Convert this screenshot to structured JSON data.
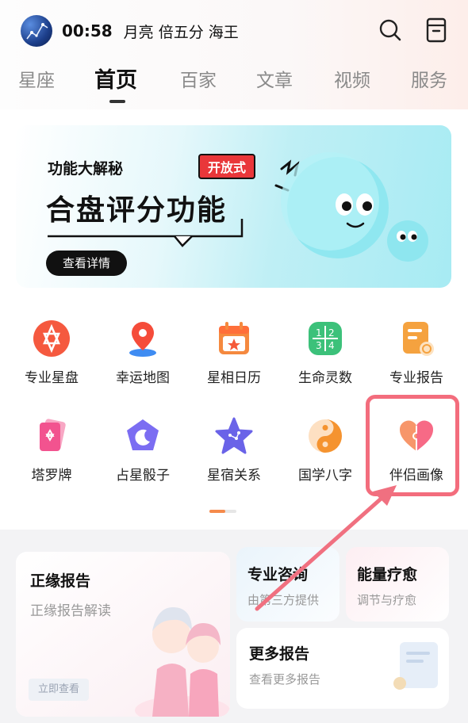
{
  "status": {
    "time": "00:58",
    "text": "月亮 倍五分 海王"
  },
  "header_icons": [
    "search-icon",
    "bookmark-icon"
  ],
  "tabs": [
    {
      "label": "星座",
      "active": false
    },
    {
      "label": "首页",
      "active": true
    },
    {
      "label": "百家",
      "active": false
    },
    {
      "label": "文章",
      "active": false
    },
    {
      "label": "视频",
      "active": false
    },
    {
      "label": "服务",
      "active": false
    }
  ],
  "banner": {
    "subtitle": "功能大解秘",
    "badge": "开放式",
    "title": "合盘评分功能",
    "button": "查看详情"
  },
  "features": [
    {
      "label": "专业星盘",
      "icon": "star-of-david-icon",
      "color": "#f5593f"
    },
    {
      "label": "幸运地图",
      "icon": "map-pin-icon",
      "color": "#f54c3a"
    },
    {
      "label": "星相日历",
      "icon": "calendar-icon",
      "color": "#f5893f"
    },
    {
      "label": "生命灵数",
      "icon": "numbers-grid-icon",
      "color": "#3cc17a"
    },
    {
      "label": "专业报告",
      "icon": "report-icon",
      "color": "#f5a23f"
    },
    {
      "label": "塔罗牌",
      "icon": "tarot-card-icon",
      "color": "#f2538f"
    },
    {
      "label": "占星骰子",
      "icon": "dice-moon-icon",
      "color": "#7b6df2"
    },
    {
      "label": "星宿关系",
      "icon": "star-icon",
      "color": "#6a63e8"
    },
    {
      "label": "国学八字",
      "icon": "yin-yang-icon",
      "color": "#f5932f"
    },
    {
      "label": "伴侣画像",
      "icon": "heart-icon",
      "color": "#f7766a"
    }
  ],
  "cards": {
    "main": {
      "title": "正缘报告",
      "subtitle": "正缘报告解读",
      "button": "立即查看"
    },
    "consult": {
      "title": "专业咨询",
      "subtitle": "由第三方提供"
    },
    "energy": {
      "title": "能量疗愈",
      "subtitle": "调节与疗愈"
    },
    "more": {
      "title": "更多报告",
      "subtitle": "查看更多报告"
    }
  },
  "colors": {
    "highlight": "#f36d7d",
    "accent": "#f58a4b"
  }
}
